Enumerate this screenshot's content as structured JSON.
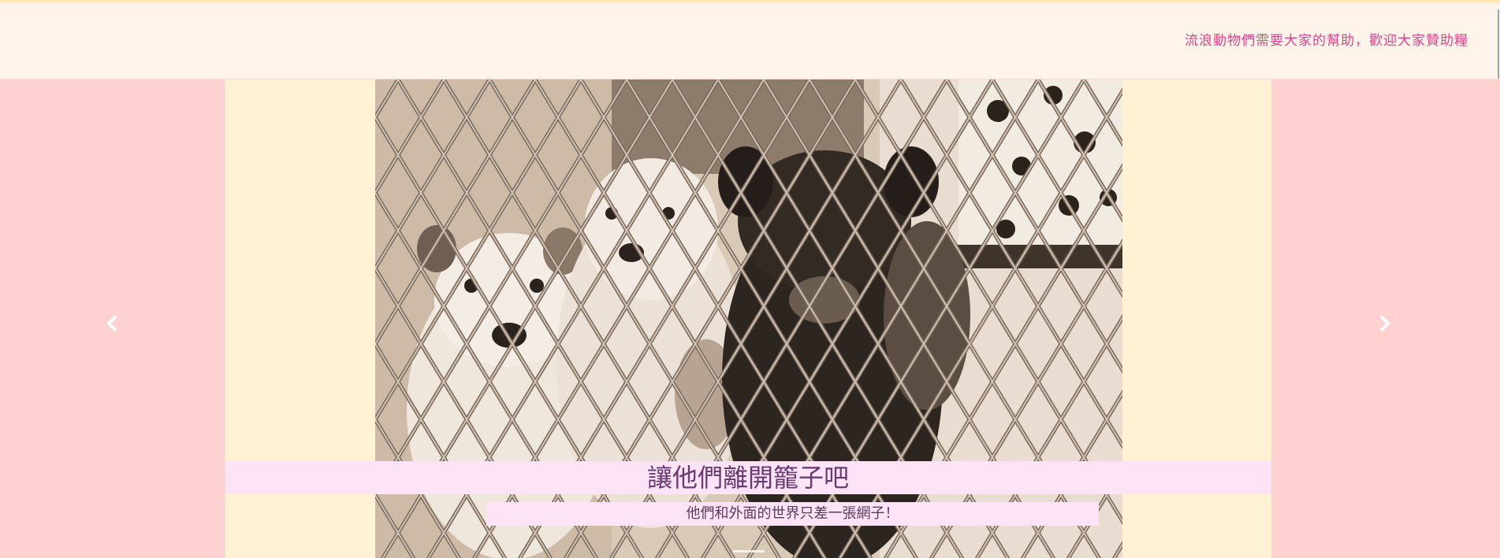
{
  "header": {
    "marquee_text": "流浪動物們需要大家的幫助，歡迎大家贊助糧"
  },
  "carousel": {
    "prev_icon": "chevron-left-icon",
    "next_icon": "chevron-right-icon",
    "slide": {
      "title": "讓他們離開籠子吧",
      "subtitle": "他們和外面的世界只差一張網子！"
    }
  },
  "colors": {
    "side_panels": "#ffd1d1",
    "content_bg": "#fff1d3",
    "header_bg": "#fff4ea",
    "marquee_text": "#e0448a",
    "caption_bg": "#fce4f6",
    "caption_text": "#6a3a73"
  }
}
